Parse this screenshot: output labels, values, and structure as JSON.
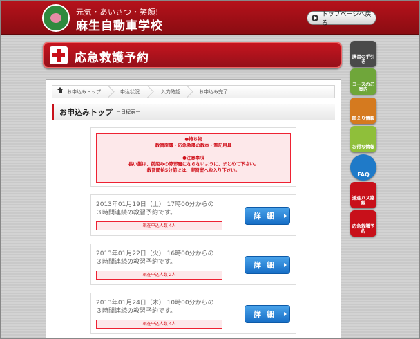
{
  "header": {
    "tagline": "元気・あいさつ・笑顔!",
    "brand": "麻生自動車学校",
    "top_button": "トップページへ戻る"
  },
  "title_bar": {
    "title": "応急救護予約"
  },
  "side_menu": [
    {
      "label": "講習の手引き",
      "color": "#4a4a4a"
    },
    {
      "label": "コースのご案内",
      "color": "#6fa63a"
    },
    {
      "label": "暗えり情報",
      "color": "#d57a1f"
    },
    {
      "label": "お得な情報",
      "color": "#8fbf3a"
    },
    {
      "label": "FAQ",
      "color": "#1f7ac8"
    },
    {
      "label": "送迎バス路線",
      "color": "#c8101a"
    },
    {
      "label": "応急救護予約",
      "color": "#c8101a"
    }
  ],
  "breadcrumb": [
    "お申込みトップ",
    "申込状況",
    "入力確認",
    "お申込み完了"
  ],
  "section": {
    "title": "お申込みトップ",
    "subtitle": "－日程表－"
  },
  "notice": {
    "bring_head": "●持ち物",
    "bring_text": "教習原簿・応急救護の教本・筆記用具",
    "caution_head": "●注意事項",
    "caution_line1": "長い髪は、前屈みの際邪魔にならないように、まとめて下さい。",
    "caution_line2": "教習開始5分前には、実習室へお入り下さい。"
  },
  "sessions": [
    {
      "line1": "2013年01月19日（土） 17時00分からの",
      "line2": "３時間連続の教習予約です。",
      "count": "現在申込人数 4人",
      "button": "詳 細"
    },
    {
      "line1": "2013年01月22日（火） 16時00分からの",
      "line2": "３時間連続の教習予約です。",
      "count": "現在申込人数 2人",
      "button": "詳 細"
    },
    {
      "line1": "2013年01月24日（木） 10時00分からの",
      "line2": "３時間連続の教習予約です。",
      "count": "現在申込人数 4人",
      "button": "詳 細"
    }
  ]
}
